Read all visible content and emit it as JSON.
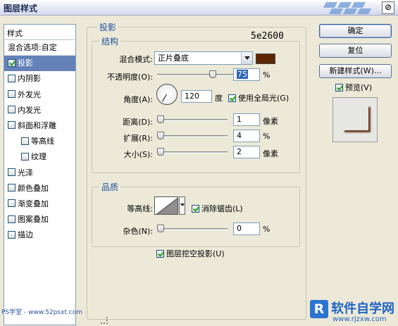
{
  "window": {
    "title": "图层样式",
    "close_icon": "⊘"
  },
  "style_list": {
    "header": "样式",
    "blend_options": "混合选项:自定",
    "items": [
      {
        "label": "投影",
        "checked": true,
        "selected": true,
        "sub": false
      },
      {
        "label": "内阴影",
        "checked": false,
        "selected": false,
        "sub": false
      },
      {
        "label": "外发光",
        "checked": false,
        "selected": false,
        "sub": false
      },
      {
        "label": "内发光",
        "checked": false,
        "selected": false,
        "sub": false
      },
      {
        "label": "斜面和浮雕",
        "checked": false,
        "selected": false,
        "sub": false
      },
      {
        "label": "等高线",
        "checked": false,
        "selected": false,
        "sub": true
      },
      {
        "label": "纹理",
        "checked": false,
        "selected": false,
        "sub": true
      },
      {
        "label": "光泽",
        "checked": false,
        "selected": false,
        "sub": false
      },
      {
        "label": "颜色叠加",
        "checked": false,
        "selected": false,
        "sub": false
      },
      {
        "label": "渐变叠加",
        "checked": false,
        "selected": false,
        "sub": false
      },
      {
        "label": "图案叠加",
        "checked": false,
        "selected": false,
        "sub": false
      },
      {
        "label": "描边",
        "checked": false,
        "selected": false,
        "sub": false
      }
    ]
  },
  "drop_shadow": {
    "title": "投影",
    "structure": {
      "title": "结构",
      "blend_mode_label": "混合模式:",
      "blend_mode_value": "正片叠底",
      "color_hex_label": "5e2600",
      "color": "#5e2600",
      "opacity_label": "不透明度(O):",
      "opacity_value": "75",
      "opacity_unit": "%",
      "opacity_level": 0.75,
      "angle_label": "角度(A):",
      "angle_value": "120",
      "angle_unit": "度",
      "global_light_label": "使用全局光(G)",
      "global_light_checked": true,
      "distance_label": "距离(D):",
      "distance_value": "1",
      "distance_unit": "像素",
      "spread_label": "扩展(R):",
      "spread_value": "4",
      "spread_unit": "%",
      "size_label": "大小(S):",
      "size_value": "2",
      "size_unit": "像素"
    },
    "quality": {
      "title": "品质",
      "contour_label": "等高线:",
      "anti_alias_label": "消除锯齿(L)",
      "anti_alias_checked": true,
      "noise_label": "杂色(N):",
      "noise_value": "0",
      "noise_unit": "%"
    },
    "knockout_label": "图层挖空投影(U)",
    "knockout_checked": true
  },
  "buttons": {
    "ok": "确定",
    "reset": "复位",
    "new_style": "新建样式(W)...",
    "preview_label": "预览(V)",
    "preview_checked": true
  },
  "watermarks": {
    "left": "PS学堂 - www.52psxt.com",
    "brand_logo": "R",
    "brand_name": "软件自学网",
    "brand_url": "www.rjzxw.com"
  }
}
